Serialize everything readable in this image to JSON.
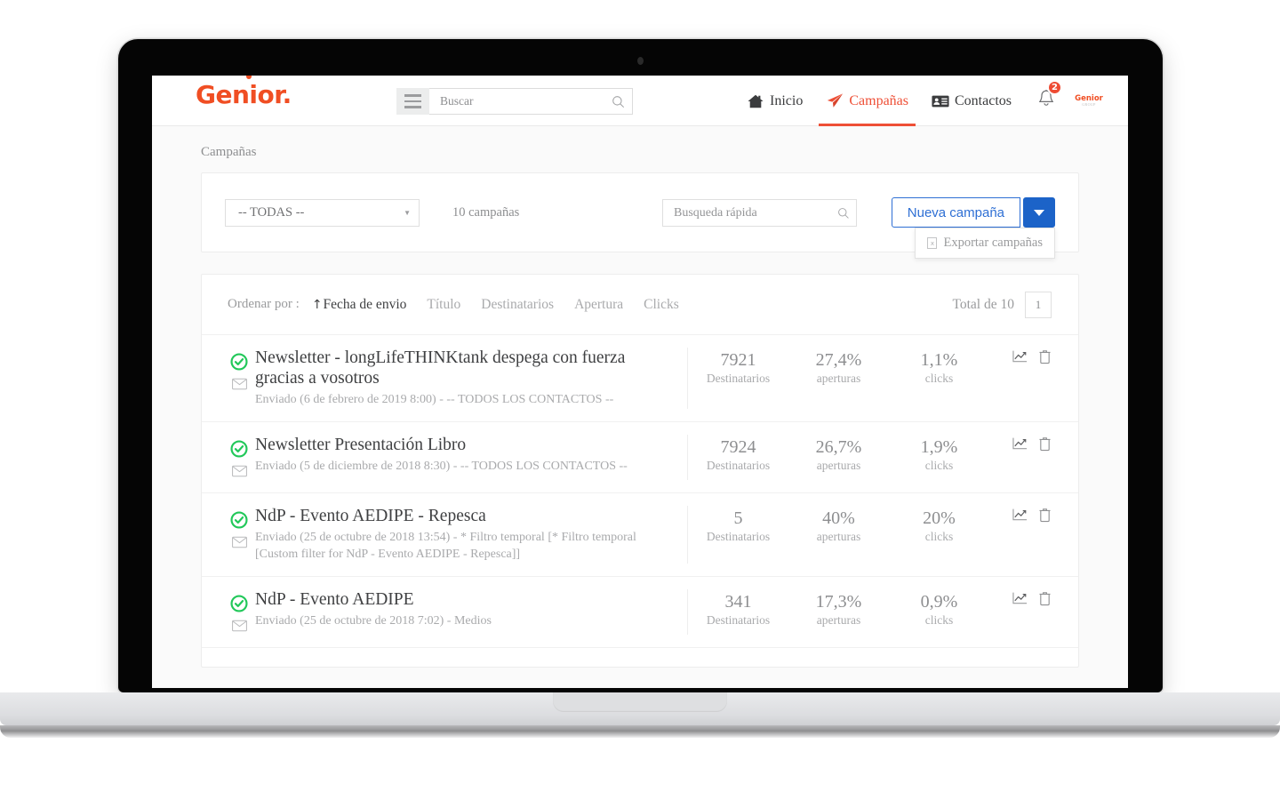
{
  "brand": {
    "name": "Genior",
    "period": "."
  },
  "header": {
    "search_placeholder": "Buscar",
    "search_value": "",
    "menu_icon": "hamburger-icon",
    "nav": [
      {
        "label": "Inicio",
        "icon": "home-icon",
        "active": false
      },
      {
        "label": "Campañas",
        "icon": "paper-plane-icon",
        "active": true
      },
      {
        "label": "Contactos",
        "icon": "contact-card-icon",
        "active": false
      }
    ],
    "notifications": {
      "icon": "bell-icon",
      "count": "2"
    },
    "avatar": {
      "label": "Genior",
      "sub": "GROUP"
    }
  },
  "breadcrumb": "Campañas",
  "toolbar": {
    "filter_selected": "-- TODAS --",
    "count_label": "10 campañas",
    "quick_search_placeholder": "Busqueda rápida",
    "quick_search_value": "",
    "new_campaign_label": "Nueva campaña",
    "dropdown_caret_icon": "chevron-down-icon",
    "dropdown_items": [
      {
        "label": "Exportar campañas",
        "icon": "excel-file-icon"
      }
    ]
  },
  "sortbar": {
    "label": "Ordenar por :",
    "options": [
      {
        "label": "Fecha de envio",
        "active": true,
        "arrow": "↑"
      },
      {
        "label": "Título",
        "active": false
      },
      {
        "label": "Destinatarios",
        "active": false
      },
      {
        "label": "Apertura",
        "active": false
      },
      {
        "label": "Clicks",
        "active": false
      }
    ],
    "total_label": "Total de 10",
    "page_number": "1"
  },
  "stat_labels": {
    "recipients": "Destinatarios",
    "opens": "aperturas",
    "clicks": "clicks"
  },
  "row_actions": {
    "stats_icon": "chart-line-icon",
    "delete_icon": "trash-icon"
  },
  "campaigns": [
    {
      "status_icon": "check-circle-icon",
      "type_icon": "envelope-icon",
      "title": "Newsletter - longLifeTHINKtank despega con fuerza gracias a vosotros",
      "subtitle": "Enviado (6 de febrero de 2019 8:00) - -- TODOS LOS CONTACTOS --",
      "recipients": "7921",
      "opens": "27,4%",
      "clicks": "1,1%"
    },
    {
      "status_icon": "check-circle-icon",
      "type_icon": "envelope-icon",
      "title": "Newsletter Presentación Libro",
      "subtitle": "Enviado (5 de diciembre de 2018 8:30) - -- TODOS LOS CONTACTOS --",
      "recipients": "7924",
      "opens": "26,7%",
      "clicks": "1,9%"
    },
    {
      "status_icon": "check-circle-icon",
      "type_icon": "envelope-icon",
      "title": "NdP - Evento AEDIPE - Repesca",
      "subtitle": "Enviado (25 de octubre de 2018 13:54) - * Filtro temporal [* Filtro temporal [Custom filter for NdP - Evento AEDIPE - Repesca]]",
      "recipients": "5",
      "opens": "40%",
      "clicks": "20%"
    },
    {
      "status_icon": "check-circle-icon",
      "type_icon": "envelope-icon",
      "title": "NdP - Evento AEDIPE",
      "subtitle": "Enviado (25 de octubre de 2018 7:02) - Medios",
      "recipients": "341",
      "opens": "17,3%",
      "clicks": "0,9%"
    }
  ],
  "colors": {
    "brand_orange": "#f04e23",
    "nav_active": "#ee4f36",
    "primary_blue": "#2e6fd4",
    "caret_blue": "#1c63c8",
    "success_green": "#22c85a",
    "badge_red": "#ee4b33"
  }
}
